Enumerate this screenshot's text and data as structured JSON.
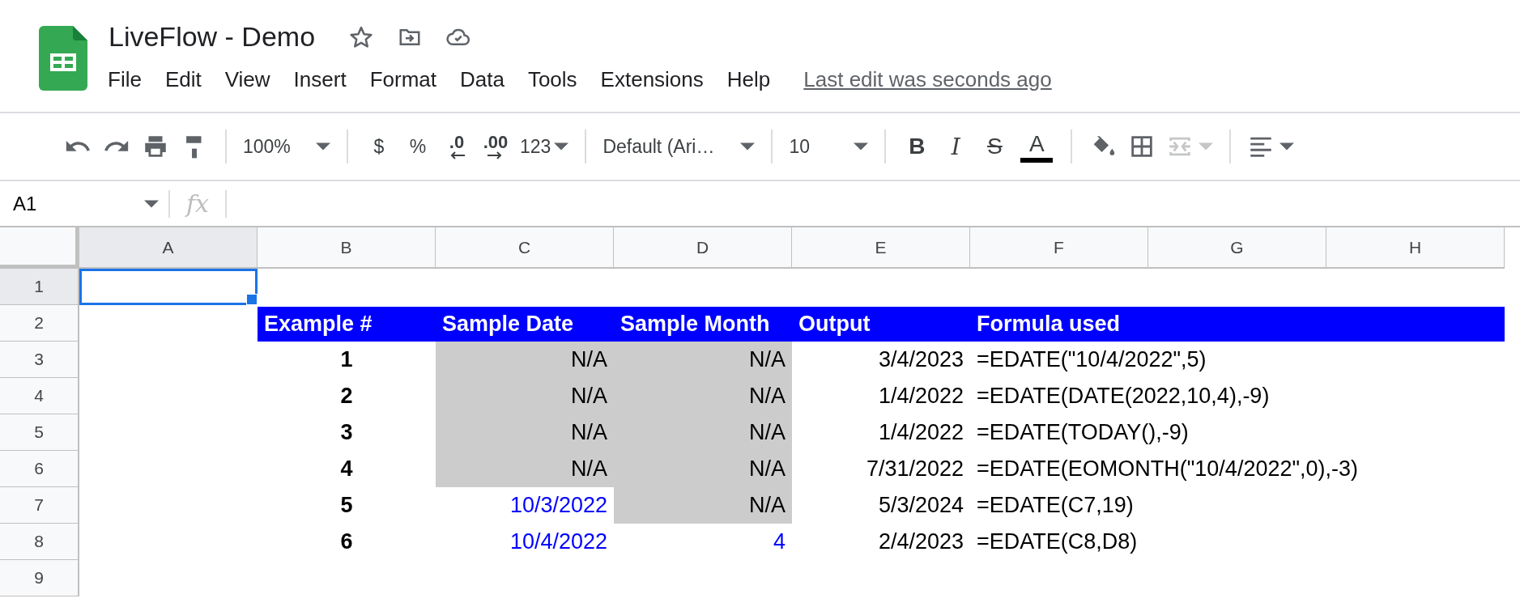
{
  "document": {
    "title": "LiveFlow - Demo"
  },
  "menu": [
    {
      "label": "File"
    },
    {
      "label": "Edit"
    },
    {
      "label": "View"
    },
    {
      "label": "Insert"
    },
    {
      "label": "Format"
    },
    {
      "label": "Data"
    },
    {
      "label": "Tools"
    },
    {
      "label": "Extensions"
    },
    {
      "label": "Help"
    }
  ],
  "last_edit": "Last edit was seconds ago",
  "toolbar": {
    "zoom": "100%",
    "currency": "$",
    "percent": "%",
    "decrease_decimals": ".0",
    "increase_decimals": ".00",
    "number_format": "123",
    "font": "Default (Ari…",
    "font_size": "10",
    "bold": "B",
    "italic": "I",
    "strikethrough": "S",
    "text_color": "A",
    "merge_disabled": true
  },
  "formula_bar": {
    "name_box": "A1",
    "fx": "fx"
  },
  "columns": [
    {
      "label": "A",
      "selected": true
    },
    {
      "label": "B",
      "selected": false
    },
    {
      "label": "C",
      "selected": false
    },
    {
      "label": "D",
      "selected": false
    },
    {
      "label": "E",
      "selected": false
    },
    {
      "label": "F",
      "selected": false
    },
    {
      "label": "G",
      "selected": false
    },
    {
      "label": "H",
      "selected": false
    }
  ],
  "rows": [
    {
      "number": "1",
      "selected": true,
      "kind": "plain"
    },
    {
      "number": "2",
      "selected": false,
      "kind": "header",
      "cells": {
        "B": {
          "kind": "header",
          "text": "Example #"
        },
        "C": {
          "kind": "header",
          "text": "Sample Date"
        },
        "D": {
          "kind": "header",
          "text": "Sample Month"
        },
        "E": {
          "kind": "header",
          "text": "Output"
        },
        "F": {
          "kind": "header",
          "text": "Formula used"
        }
      }
    },
    {
      "number": "3",
      "selected": false,
      "kind": "plain",
      "cells": {
        "B": {
          "kind": "index",
          "text": "1"
        },
        "C": {
          "kind": "na",
          "text": "N/A"
        },
        "D": {
          "kind": "na",
          "text": "N/A"
        },
        "E": {
          "kind": "output",
          "text": "3/4/2023"
        },
        "F": {
          "kind": "formula",
          "text": "=EDATE(\"10/4/2022\",5)"
        }
      }
    },
    {
      "number": "4",
      "selected": false,
      "kind": "plain",
      "cells": {
        "B": {
          "kind": "index",
          "text": "2"
        },
        "C": {
          "kind": "na",
          "text": "N/A"
        },
        "D": {
          "kind": "na",
          "text": "N/A"
        },
        "E": {
          "kind": "output",
          "text": "1/4/2022"
        },
        "F": {
          "kind": "formula",
          "text": "=EDATE(DATE(2022,10,4),-9)"
        }
      }
    },
    {
      "number": "5",
      "selected": false,
      "kind": "plain",
      "cells": {
        "B": {
          "kind": "index",
          "text": "3"
        },
        "C": {
          "kind": "na",
          "text": "N/A"
        },
        "D": {
          "kind": "na",
          "text": "N/A"
        },
        "E": {
          "kind": "output",
          "text": "1/4/2022"
        },
        "F": {
          "kind": "formula",
          "text": "=EDATE(TODAY(),-9)"
        }
      }
    },
    {
      "number": "6",
      "selected": false,
      "kind": "plain",
      "cells": {
        "B": {
          "kind": "index",
          "text": "4"
        },
        "C": {
          "kind": "na",
          "text": "N/A"
        },
        "D": {
          "kind": "na",
          "text": "N/A"
        },
        "E": {
          "kind": "output",
          "text": "7/31/2022"
        },
        "F": {
          "kind": "formula",
          "text": "=EDATE(EOMONTH(\"10/4/2022\",0),-3)"
        }
      }
    },
    {
      "number": "7",
      "selected": false,
      "kind": "plain",
      "cells": {
        "B": {
          "kind": "index",
          "text": "5"
        },
        "C": {
          "kind": "input",
          "text": "10/3/2022"
        },
        "D": {
          "kind": "na",
          "text": "N/A"
        },
        "E": {
          "kind": "output",
          "text": "5/3/2024"
        },
        "F": {
          "kind": "formula",
          "text": "=EDATE(C7,19)"
        }
      }
    },
    {
      "number": "8",
      "selected": false,
      "kind": "plain",
      "cells": {
        "B": {
          "kind": "index",
          "text": "6"
        },
        "C": {
          "kind": "input",
          "text": "10/4/2022"
        },
        "D": {
          "kind": "input",
          "text": "4"
        },
        "E": {
          "kind": "output",
          "text": "2/4/2023"
        },
        "F": {
          "kind": "formula",
          "text": "=EDATE(C8,D8)"
        }
      }
    },
    {
      "number": "9",
      "selected": false,
      "kind": "plain"
    }
  ]
}
